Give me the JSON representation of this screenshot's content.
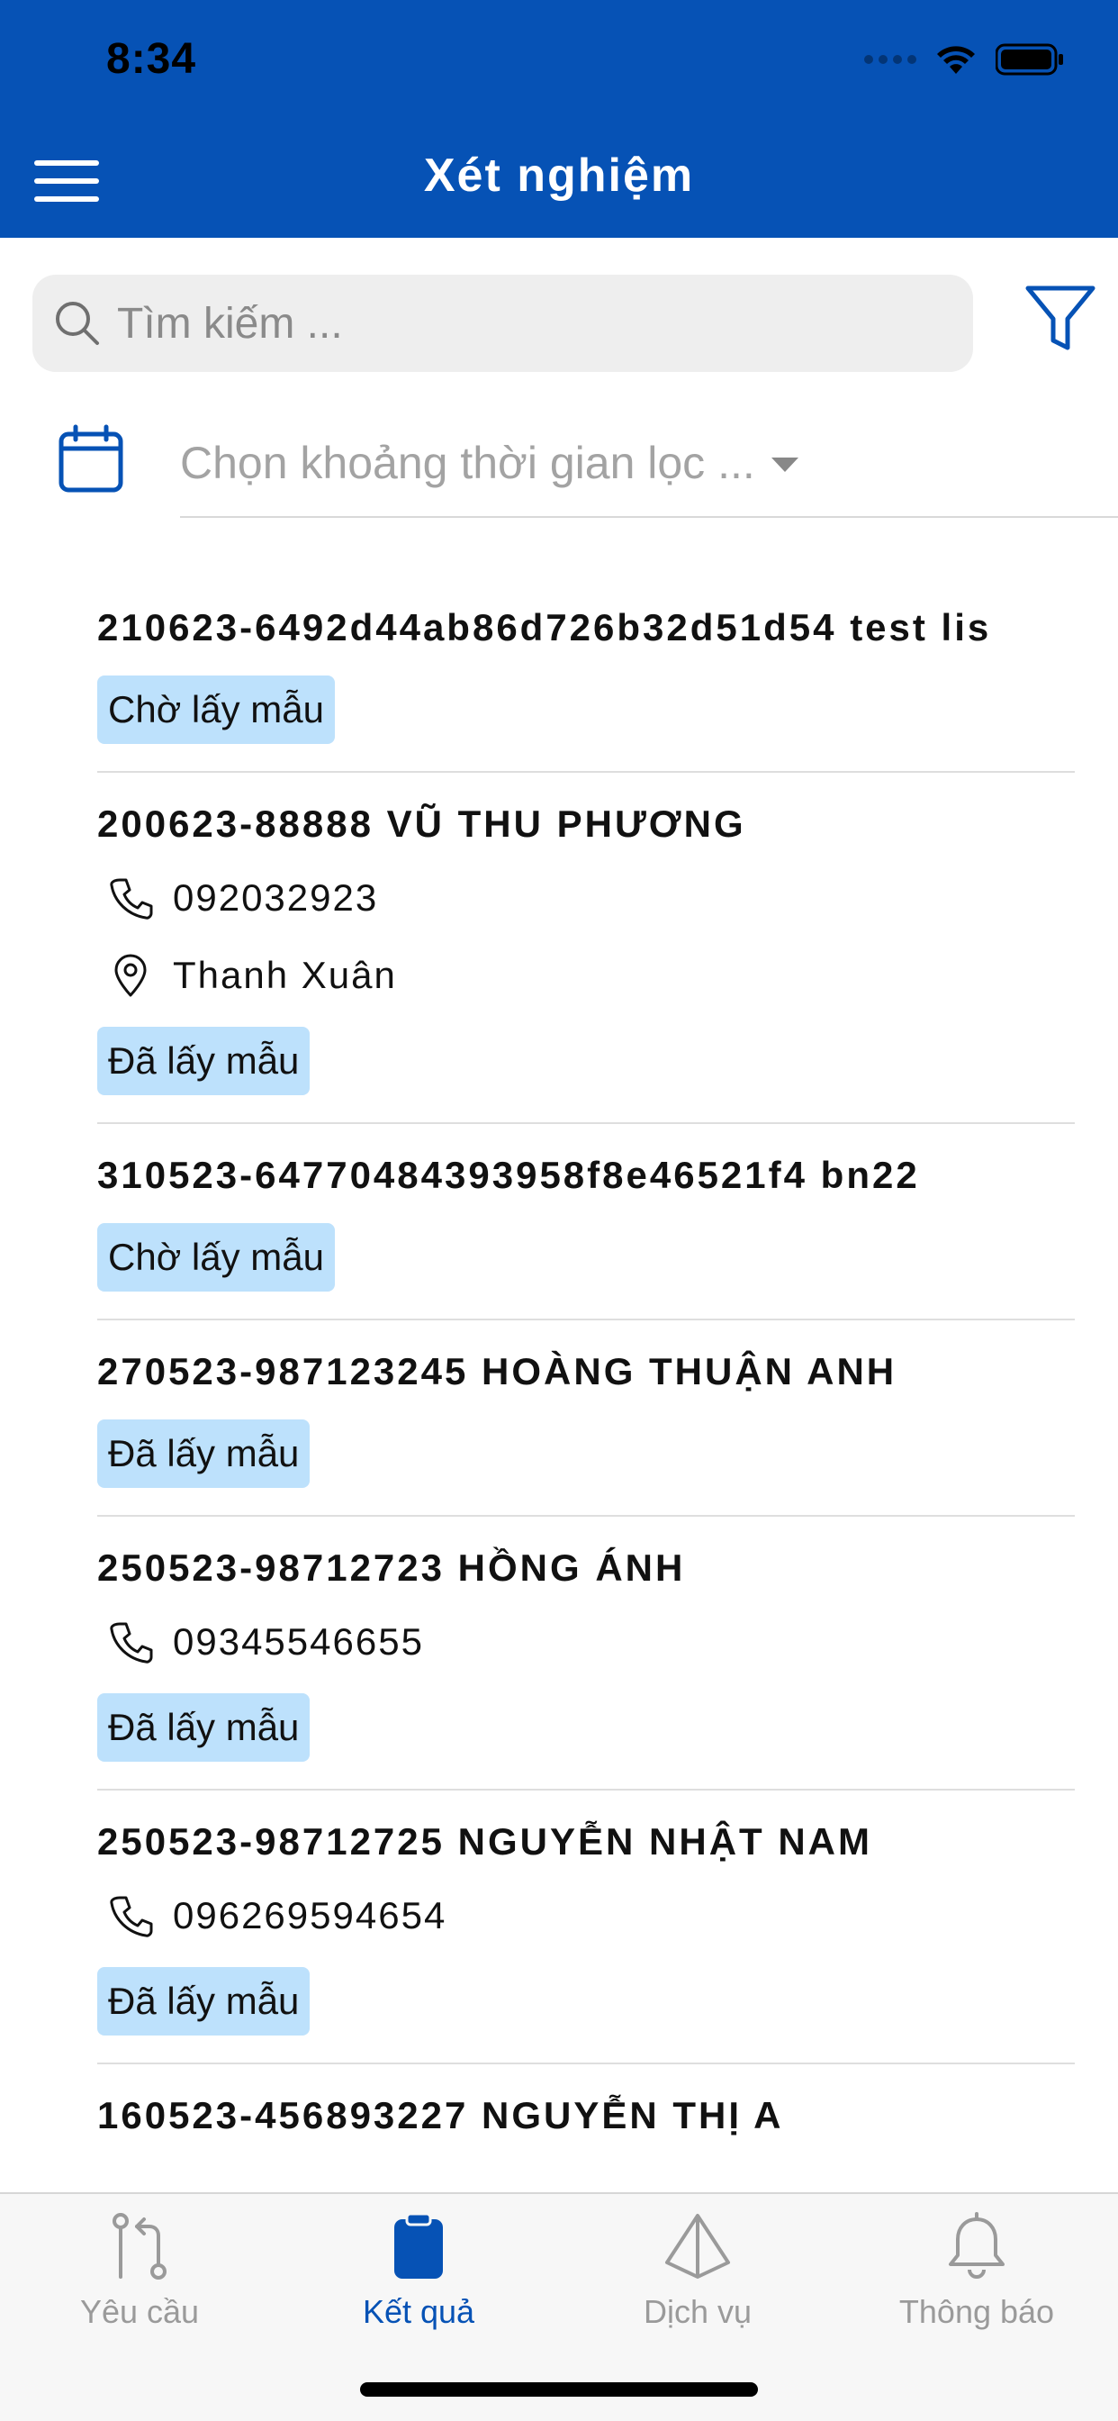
{
  "status_bar": {
    "time": "8:34"
  },
  "header": {
    "title": "Xét nghiệm"
  },
  "search": {
    "placeholder": "Tìm kiếm ..."
  },
  "date_filter": {
    "placeholder": "Chọn khoảng thời gian lọc ..."
  },
  "items": [
    {
      "title": "210623-6492d44ab86d726b32d51d54 test lis",
      "phone": null,
      "address": null,
      "status": "Chờ lấy mẫu"
    },
    {
      "title": "200623-88888 VŨ THU PHƯƠNG",
      "phone": "092032923",
      "address": "Thanh Xuân",
      "status": "Đã lấy mẫu"
    },
    {
      "title": "310523-64770484393958f8e46521f4 bn22",
      "phone": null,
      "address": null,
      "status": "Chờ lấy mẫu"
    },
    {
      "title": "270523-987123245 HOÀNG THUẬN ANH",
      "phone": null,
      "address": null,
      "status": "Đã lấy mẫu"
    },
    {
      "title": "250523-98712723 HỒNG ÁNH",
      "phone": "09345546655",
      "address": null,
      "status": "Đã lấy mẫu"
    },
    {
      "title": "250523-98712725 NGUYỄN NHẬT NAM",
      "phone": "096269594654",
      "address": null,
      "status": "Đã lấy mẫu"
    },
    {
      "title": "160523-456893227 NGUYỄN THỊ A",
      "phone": null,
      "address": null,
      "status": null
    }
  ],
  "tabs": [
    {
      "label": "Yêu cầu",
      "icon": "git-compare-icon",
      "active": false
    },
    {
      "label": "Kết quả",
      "icon": "clipboard-icon",
      "active": true
    },
    {
      "label": "Dịch vụ",
      "icon": "prism-icon",
      "active": false
    },
    {
      "label": "Thông báo",
      "icon": "bell-icon",
      "active": false
    }
  ],
  "colors": {
    "primary": "#0652B5",
    "badge": "#BDE1FC",
    "inactive": "#9A9A9A"
  }
}
